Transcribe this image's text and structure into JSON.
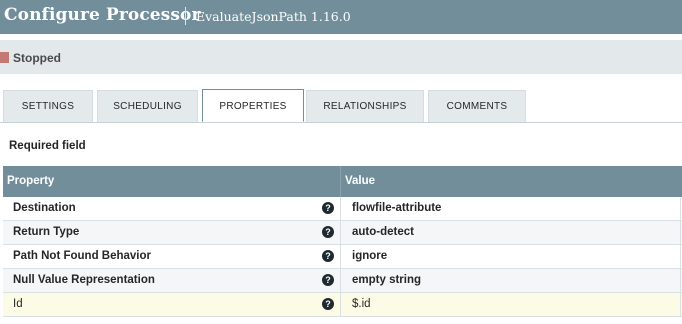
{
  "dialog": {
    "title": "Configure Processor",
    "subtitle": "EvaluateJsonPath 1.16.0"
  },
  "status": {
    "label": "Stopped",
    "icon": "stopped-square-icon",
    "color": "#ba554a"
  },
  "tabs": [
    {
      "label": "SETTINGS"
    },
    {
      "label": "SCHEDULING"
    },
    {
      "label": "PROPERTIES",
      "active": true
    },
    {
      "label": "RELATIONSHIPS"
    },
    {
      "label": "COMMENTS"
    }
  ],
  "required_label": "Required field",
  "grid": {
    "headers": {
      "property": "Property",
      "value": "Value"
    },
    "rows": [
      {
        "property": "Destination",
        "value": "flowfile-attribute"
      },
      {
        "property": "Return Type",
        "value": "auto-detect"
      },
      {
        "property": "Path Not Found Behavior",
        "value": "ignore"
      },
      {
        "property": "Null Value Representation",
        "value": "empty string"
      },
      {
        "property": "Id",
        "value": "$.id"
      }
    ],
    "help_icon": "?"
  },
  "colors": {
    "header_bg": "#728e9b",
    "status_bg": "#e3e8eb",
    "highlight_row": "#fcfbe6"
  }
}
